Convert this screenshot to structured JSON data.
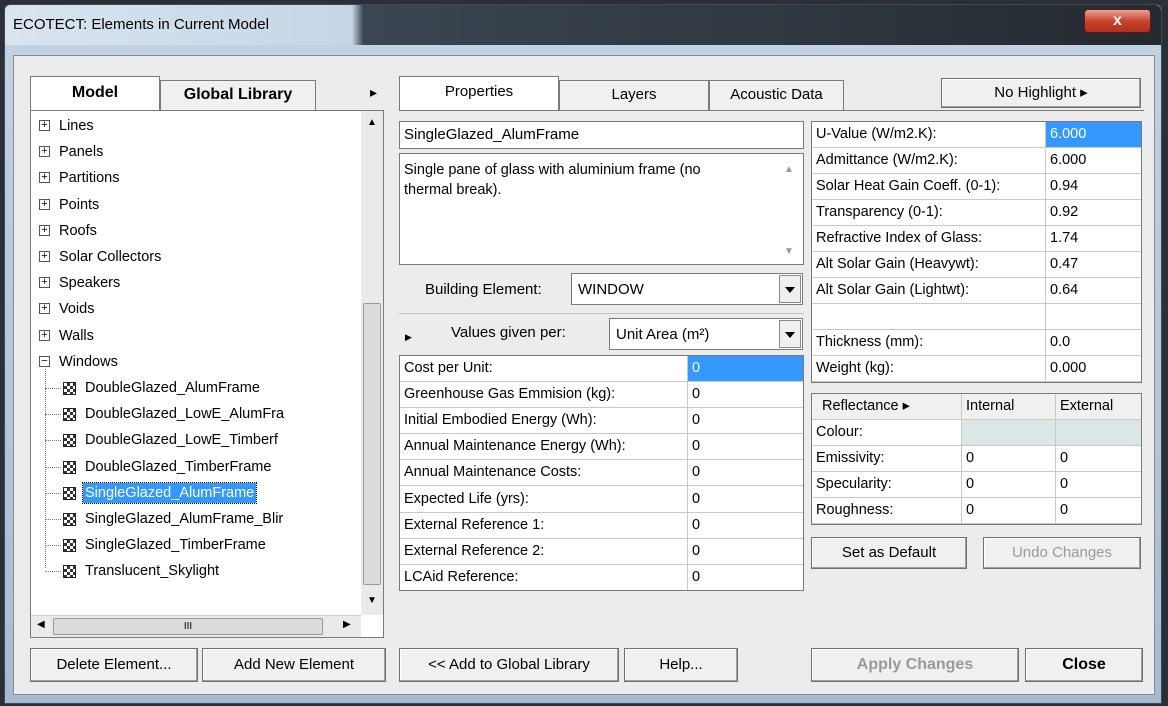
{
  "window": {
    "title": "ECOTECT: Elements in Current Model",
    "close_glyph": "x"
  },
  "left_tabs": {
    "model": "Model",
    "global_library": "Global Library",
    "more": "▸"
  },
  "tree": {
    "categories": [
      {
        "expander": "+",
        "label": "Lines"
      },
      {
        "expander": "+",
        "label": "Panels"
      },
      {
        "expander": "+",
        "label": "Partitions"
      },
      {
        "expander": "+",
        "label": "Points"
      },
      {
        "expander": "+",
        "label": "Roofs"
      },
      {
        "expander": "+",
        "label": "Solar Collectors"
      },
      {
        "expander": "+",
        "label": "Speakers"
      },
      {
        "expander": "+",
        "label": "Voids"
      },
      {
        "expander": "+",
        "label": "Walls"
      },
      {
        "expander": "−",
        "label": "Windows"
      }
    ],
    "windows_children": [
      "DoubleGlazed_AlumFrame",
      "DoubleGlazed_LowE_AlumFra",
      "DoubleGlazed_LowE_Timberf",
      "DoubleGlazed_TimberFrame",
      "SingleGlazed_AlumFrame",
      "SingleGlazed_AlumFrame_Blir",
      "SingleGlazed_TimberFrame",
      "Translucent_Skylight"
    ],
    "hscroll_thumb": "III"
  },
  "right_tabs": {
    "properties": "Properties",
    "layers": "Layers",
    "acoustic": "Acoustic Data",
    "highlight": "No Highlight ▸"
  },
  "element": {
    "name": "SingleGlazed_AlumFrame",
    "description": "Single pane of glass with aluminium frame (no thermal break).",
    "building_element_label": "Building Element:",
    "building_element_value": "WINDOW",
    "values_given_per_label": "Values given per:",
    "values_given_per_value": "Unit Area (m²)"
  },
  "cost_table": [
    {
      "label": "Cost per Unit:",
      "value": "0"
    },
    {
      "label": "Greenhouse Gas Emmision (kg):",
      "value": "0"
    },
    {
      "label": "Initial Embodied Energy (Wh):",
      "value": "0"
    },
    {
      "label": "Annual Maintenance Energy (Wh):",
      "value": "0"
    },
    {
      "label": "Annual Maintenance Costs:",
      "value": "0"
    },
    {
      "label": "Expected Life (yrs):",
      "value": "0"
    },
    {
      "label": "External Reference 1:",
      "value": "0"
    },
    {
      "label": "External Reference 2:",
      "value": "0"
    },
    {
      "label": "LCAid Reference:",
      "value": "0"
    }
  ],
  "thermal_table": [
    {
      "label": "U-Value (W/m2.K):",
      "value": "6.000"
    },
    {
      "label": "Admittance (W/m2.K):",
      "value": "6.000"
    },
    {
      "label": "Solar Heat Gain Coeff. (0-1):",
      "value": "0.94"
    },
    {
      "label": "Transparency (0-1):",
      "value": "0.92"
    },
    {
      "label": "Refractive Index of Glass:",
      "value": "1.74"
    },
    {
      "label": "Alt Solar Gain (Heavywt):",
      "value": "0.47"
    },
    {
      "label": "Alt Solar Gain (Lightwt):",
      "value": "0.64"
    },
    {
      "label": "",
      "value": ""
    },
    {
      "label": "Thickness (mm):",
      "value": "0.0"
    },
    {
      "label": "Weight (kg):",
      "value": "0.000"
    }
  ],
  "reflectance": {
    "header": "Reflectance ▸",
    "internal": "Internal",
    "external": "External",
    "rows": [
      {
        "label": "Colour:",
        "internal": "",
        "external": ""
      },
      {
        "label": "Emissivity:",
        "internal": "0",
        "external": "0"
      },
      {
        "label": "Specularity:",
        "internal": "0",
        "external": "0"
      },
      {
        "label": "Roughness:",
        "internal": "0",
        "external": "0"
      }
    ]
  },
  "buttons": {
    "set_default": "Set as Default",
    "undo_changes": "Undo Changes",
    "delete_element": "Delete Element...",
    "add_new_element": "Add New Element",
    "add_global": "<< Add to Global Library",
    "help": "Help...",
    "apply": "Apply Changes",
    "close": "Close"
  },
  "colors": {
    "selection": "#3399ff",
    "colour_swatch": "#dbe7e7"
  }
}
